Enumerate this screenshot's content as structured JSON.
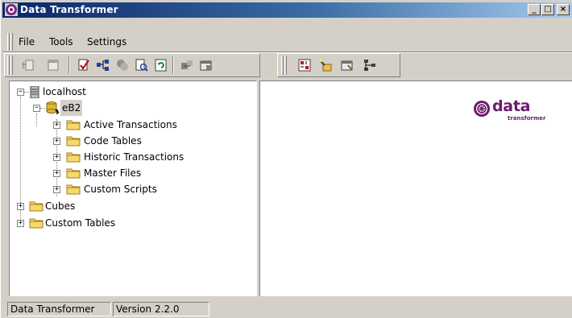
{
  "window": {
    "title": "Data Transformer",
    "controls": {
      "minimize": "_",
      "maximize": "□",
      "close": "×"
    }
  },
  "menu": {
    "items": [
      {
        "label": "File"
      },
      {
        "label": "Tools"
      },
      {
        "label": "Settings"
      }
    ]
  },
  "toolbar_left": {
    "icons": [
      "new-document-icon",
      "open-document-icon",
      "validate-check-icon",
      "tree-structure-icon",
      "database-link-icon",
      "preview-icon",
      "refresh-icon",
      "export-icon",
      "properties-icon"
    ]
  },
  "toolbar_right": {
    "icons": [
      "ruler-icon",
      "wizard-icon",
      "configure-icon",
      "network-icon"
    ]
  },
  "tree": {
    "server": "localhost",
    "database": "eB2",
    "db_children": [
      "Active Transactions",
      "Code Tables",
      "Historic Transactions",
      "Master Files",
      "Custom Scripts"
    ],
    "top_folders": [
      "Cubes",
      "Custom Tables"
    ]
  },
  "logo": {
    "word": "data",
    "subtitle": "transformer",
    "brand_color": "#6b1b6e"
  },
  "status": {
    "app": "Data Transformer",
    "version": "Version 2.2.0"
  },
  "colors": {
    "titlebar_start": "#0a246a",
    "titlebar_end": "#a6caf0",
    "face": "#d4d0c8",
    "folder": "#f7d86a"
  }
}
